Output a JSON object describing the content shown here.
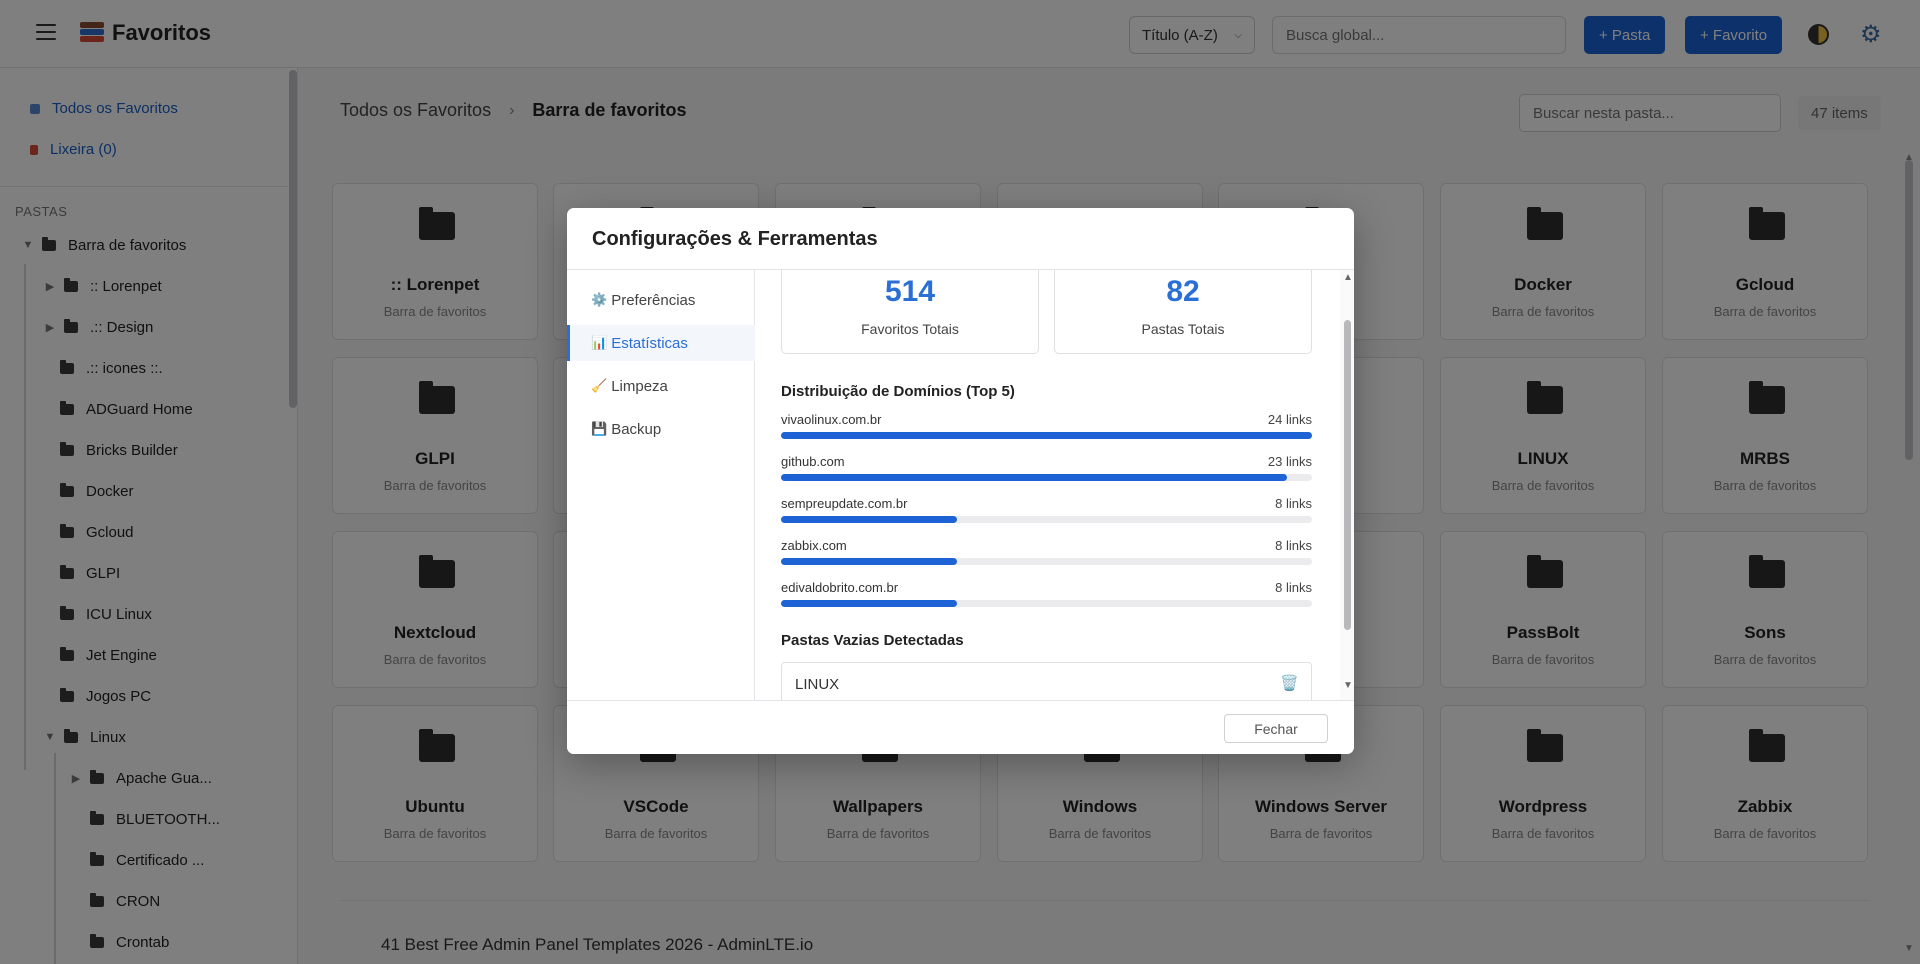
{
  "header": {
    "app_title": "Favoritos",
    "sort_value": "Título (A-Z)",
    "global_search_placeholder": "Busca global...",
    "new_folder_label": "+ Pasta",
    "new_favorite_label": "+ Favorito",
    "icons": {
      "menu": "hamburger-icon",
      "brand": "books-icon",
      "theme": "theme-toggle-icon",
      "settings": "gear-icon"
    }
  },
  "sidebar": {
    "all_favorites": "Todos os Favoritos",
    "trash": "Lixeira (0)",
    "section_label": "PASTAS",
    "tree": [
      {
        "label": "Barra de favoritos",
        "caret": "▼"
      },
      {
        "label": ":: Lorenpet",
        "caret": "▶"
      },
      {
        "label": ".:: Design",
        "caret": "▶"
      },
      {
        "label": ".:: icones ::.",
        "caret": ""
      },
      {
        "label": "ADGuard Home",
        "caret": ""
      },
      {
        "label": "Bricks Builder",
        "caret": ""
      },
      {
        "label": "Docker",
        "caret": ""
      },
      {
        "label": "Gcloud",
        "caret": ""
      },
      {
        "label": "GLPI",
        "caret": ""
      },
      {
        "label": "ICU Linux",
        "caret": ""
      },
      {
        "label": "Jet Engine",
        "caret": ""
      },
      {
        "label": "Jogos PC",
        "caret": ""
      },
      {
        "label": "Linux",
        "caret": "▼"
      },
      {
        "label": "Apache Gua...",
        "caret": "▶"
      },
      {
        "label": "BLUETOOTH...",
        "caret": ""
      },
      {
        "label": "Certificado ...",
        "caret": ""
      },
      {
        "label": "CRON",
        "caret": ""
      },
      {
        "label": "Crontab",
        "caret": ""
      }
    ]
  },
  "main": {
    "breadcrumb_root": "Todos os Favoritos",
    "breadcrumb_sep": "›",
    "breadcrumb_current": "Barra de favoritos",
    "folder_search_placeholder": "Buscar nesta pasta...",
    "items_count": "47 items",
    "cards": [
      {
        "name": ":: Lorenpet",
        "sub": "Barra de favoritos"
      },
      {
        "name": "",
        "sub": ""
      },
      {
        "name": "",
        "sub": ""
      },
      {
        "name": "der",
        "sub": "ritos"
      },
      {
        "name": "Docker",
        "sub": "Barra de favoritos"
      },
      {
        "name": "Gcloud",
        "sub": "Barra de favoritos"
      },
      {
        "name": "GLPI",
        "sub": "Barra de favoritos"
      },
      {
        "name": "",
        "sub": ""
      },
      {
        "name": "",
        "sub": ""
      },
      {
        "name": "",
        "sub": "ritos"
      },
      {
        "name": "LINUX",
        "sub": "Barra de favoritos"
      },
      {
        "name": "MRBS",
        "sub": "Barra de favoritos"
      },
      {
        "name": "Nextcloud",
        "sub": "Barra de favoritos"
      },
      {
        "name": "",
        "sub": ""
      },
      {
        "name": "",
        "sub": ""
      },
      {
        "name": "ores",
        "sub": "ritos"
      },
      {
        "name": "PassBolt",
        "sub": "Barra de favoritos"
      },
      {
        "name": "Sons",
        "sub": "Barra de favoritos"
      },
      {
        "name": "Ubuntu",
        "sub": "Barra de favoritos"
      },
      {
        "name": "VSCode",
        "sub": "Barra de favoritos"
      },
      {
        "name": "Wallpapers",
        "sub": "Barra de favoritos"
      },
      {
        "name": "Windows",
        "sub": "Barra de favoritos"
      },
      {
        "name": "Windows Server",
        "sub": "Barra de favoritos"
      },
      {
        "name": "Wordpress",
        "sub": "Barra de favoritos"
      },
      {
        "name": "Zabbix",
        "sub": "Barra de favoritos"
      }
    ],
    "link_title": "41 Best Free Admin Panel Templates 2026 - AdminLTE.io"
  },
  "modal": {
    "title": "Configurações & Ferramentas",
    "nav": [
      {
        "icon": "⚙️",
        "label": "Preferências",
        "active": false
      },
      {
        "icon": "📊",
        "label": "Estatísticas",
        "active": true
      },
      {
        "icon": "🧹",
        "label": "Limpeza",
        "active": false
      },
      {
        "icon": "💾",
        "label": "Backup",
        "active": false
      }
    ],
    "stats": [
      {
        "value": "514",
        "label": "Favoritos Totais"
      },
      {
        "value": "82",
        "label": "Pastas Totais"
      }
    ],
    "domains_title": "Distribuição de Domínios (Top 5)",
    "domains": [
      {
        "domain": "vivaolinux.com.br",
        "count": "24 links",
        "value": 24
      },
      {
        "domain": "github.com",
        "count": "23 links",
        "value": 23
      },
      {
        "domain": "sempreupdate.com.br",
        "count": "8 links",
        "value": 8
      },
      {
        "domain": "zabbix.com",
        "count": "8 links",
        "value": 8
      },
      {
        "domain": "edivaldobrito.com.br",
        "count": "8 links",
        "value": 8
      }
    ],
    "empty_title": "Pastas Vazias Detectadas",
    "empty_folders": [
      {
        "label": "LINUX",
        "icon": "trash-icon"
      }
    ],
    "close_label": "Fechar"
  },
  "colors": {
    "accent": "#1a63d6",
    "bar": "#1e63d6",
    "link": "#1a5fc6"
  }
}
